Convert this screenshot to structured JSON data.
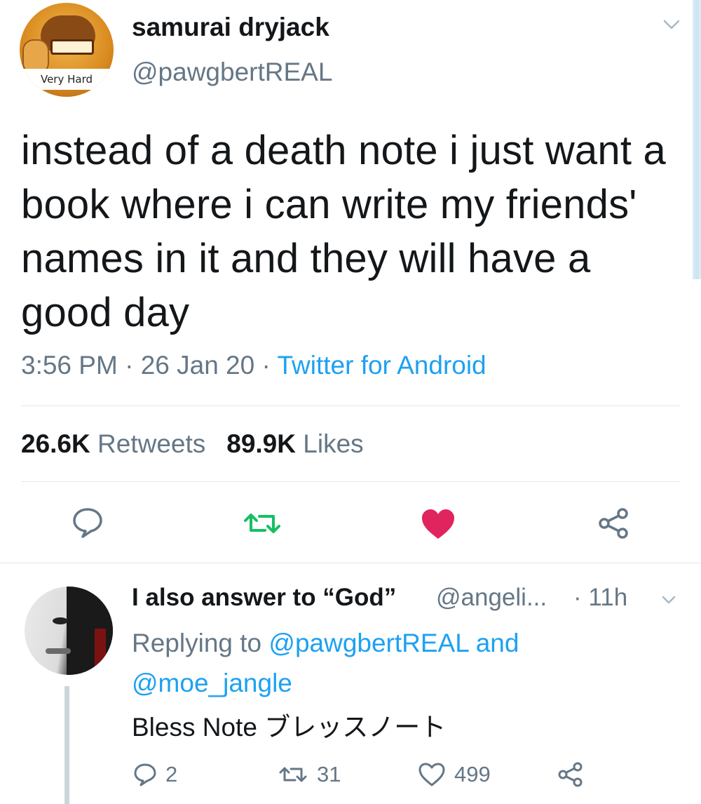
{
  "main_tweet": {
    "avatar_caption": "Very Hard",
    "display_name": "samurai dryjack",
    "handle": "@pawgbertREAL",
    "text": "instead of a death note i just want a book where i can write my friends' names in it and they will have a good day",
    "time": "3:56 PM",
    "date": "26 Jan 20",
    "separator": "·",
    "source": "Twitter for Android",
    "retweets_count": "26.6K",
    "retweets_label": "Retweets",
    "likes_count": "89.9K",
    "likes_label": "Likes",
    "actions": {
      "reply_icon": "speech-bubble-icon",
      "retweet_icon": "retweet-icon",
      "like_icon": "heart-filled-icon",
      "share_icon": "share-icon"
    }
  },
  "reply": {
    "display_name": "I also answer to “God”",
    "handle": "@angeli...",
    "time": "· 11h",
    "replying_prefix": "Replying to",
    "replying_to_1": "@pawgbertREAL",
    "replying_and": "and",
    "replying_to_2": "@moe_jangle",
    "text": "Bless Note ブレッスノート",
    "reply_count": "2",
    "retweet_count": "31",
    "like_count": "499"
  },
  "colors": {
    "text": "#14171a",
    "secondary": "#657786",
    "link": "#1da1f2",
    "retweet_green": "#17bf63",
    "like_red": "#e0245e",
    "divider": "#e1e8ed"
  }
}
